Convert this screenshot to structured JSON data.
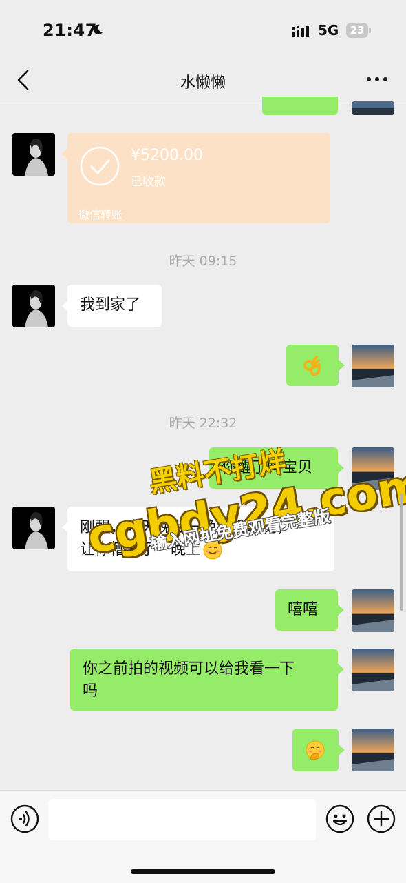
{
  "status": {
    "time": "21:47",
    "network": "5G",
    "battery": "23"
  },
  "header": {
    "title": "水懒懒"
  },
  "transfer": {
    "amount": "¥5200.00",
    "status": "已收款",
    "label": "微信转账"
  },
  "timestamps": [
    "昨天 09:15",
    "昨天 22:32"
  ],
  "messages": {
    "m1": "我到家了",
    "m3": "你醒了吗宝贝",
    "m4_line1": "刚醒，昨天晚上一晚上没睡觉，",
    "m4_line2": "让你糟蹋了一晚上",
    "m5": "嘻嘻",
    "m6_line1": "你之前拍的视频可以给我看一下",
    "m6_line2": "吗"
  },
  "watermark": {
    "line1": "黑料不打烊",
    "line2": "cgbdy24.com",
    "line3": "输入网址免费观看完整版"
  },
  "icons": [
    "moon-icon",
    "signal-icon",
    "battery-icon",
    "back-icon",
    "more-icon",
    "check-icon",
    "ok-hand-emoji",
    "smile-emoji",
    "shy-emoji",
    "voice-icon",
    "emoji-icon",
    "plus-icon"
  ],
  "colors": {
    "background": "#ededed",
    "self_bubble": "#95ec69",
    "other_bubble": "#ffffff",
    "transfer_bg": "#fde1c7",
    "watermark": "#f6d100"
  }
}
